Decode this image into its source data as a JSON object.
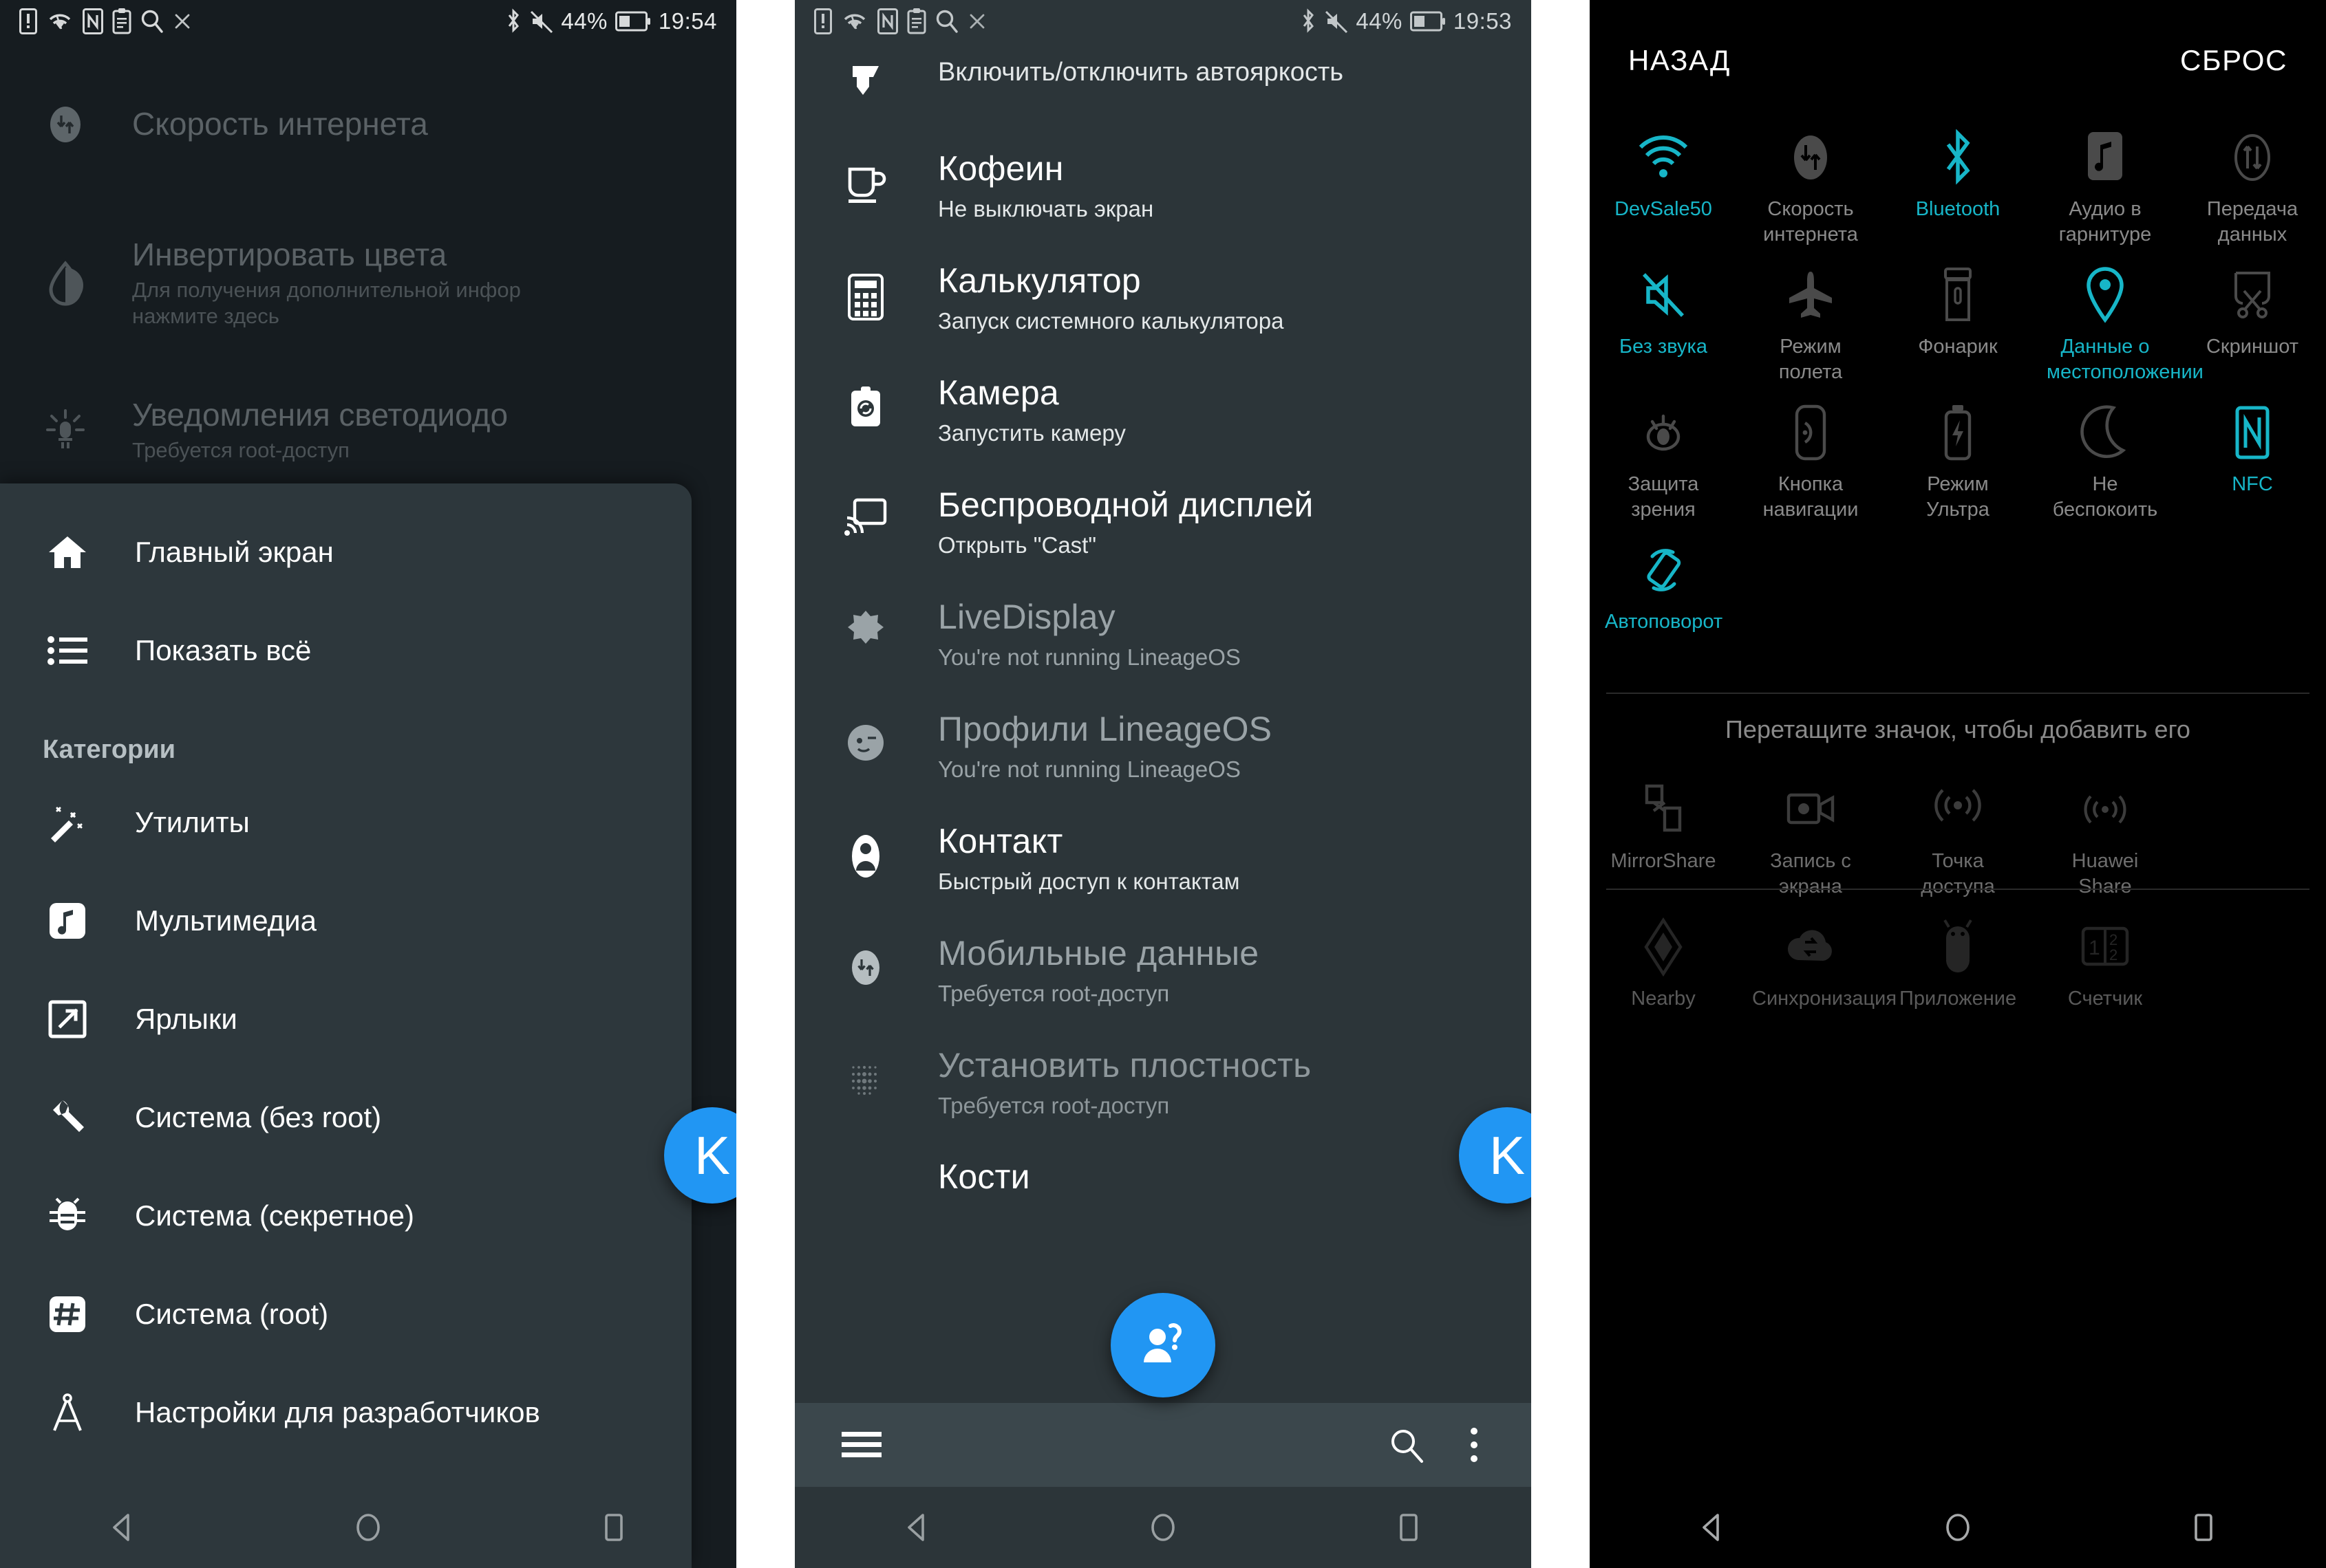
{
  "panel1": {
    "status_bar": {
      "icons": [
        "sim-alert-icon",
        "wifi-icon",
        "nfc-icon",
        "clipboard-icon",
        "search-icon",
        "close-icon"
      ],
      "right_icons": [
        "bluetooth-icon",
        "mute-icon",
        "battery-icon"
      ],
      "battery_percent": "44%",
      "clock": "19:54"
    },
    "background_rows": [
      {
        "title": "Скорость интернета",
        "sub": "",
        "icon": "data-transfer-icon"
      },
      {
        "title": "Инвертировать цвета",
        "sub": "Для получения дополнительной инфор\nнажмите здесь",
        "icon": "invert-colors-icon"
      },
      {
        "title": "Уведомления светодиодо",
        "sub": "Требуется root-доступ",
        "icon": "led-icon"
      }
    ],
    "drawer": {
      "top_items": [
        {
          "label": "Главный экран",
          "icon": "home-icon"
        },
        {
          "label": "Показать всё",
          "icon": "list-icon"
        }
      ],
      "section_header": "Категории",
      "category_items": [
        {
          "label": "Утилиты",
          "icon": "magic-wand-icon"
        },
        {
          "label": "Мультимедиа",
          "icon": "music-note-icon"
        },
        {
          "label": "Ярлыки",
          "icon": "shortcut-icon"
        },
        {
          "label": "Система (без root)",
          "icon": "wrench-icon"
        },
        {
          "label": "Система (секретное)",
          "icon": "bug-icon"
        },
        {
          "label": "Система (root)",
          "icon": "hash-icon"
        },
        {
          "label": "Настройки для разработчиков",
          "icon": "compass-icon"
        }
      ]
    },
    "fab": {
      "letter": "K",
      "color": "#2196f3"
    },
    "nav": [
      "back-icon",
      "home-icon",
      "recents-icon"
    ]
  },
  "panel2": {
    "status_bar": {
      "icons": [
        "sim-alert-icon",
        "wifi-icon",
        "nfc-icon",
        "clipboard-icon",
        "search-icon",
        "close-icon"
      ],
      "right_icons": [
        "bluetooth-icon",
        "mute-icon",
        "battery-icon"
      ],
      "battery_percent": "44%",
      "clock": "19:53"
    },
    "items": [
      {
        "title": "",
        "sub": "Включить/отключить автояркость",
        "icon": "brightness-auto-icon",
        "state": "normal"
      },
      {
        "title": "Кофеин",
        "sub": "Не выключать экран",
        "icon": "coffee-cup-icon",
        "state": "normal"
      },
      {
        "title": "Калькулятор",
        "sub": "Запуск системного калькулятора",
        "icon": "calculator-icon",
        "state": "normal"
      },
      {
        "title": "Камера",
        "sub": "Запустить камеру",
        "icon": "camera-icon",
        "state": "normal"
      },
      {
        "title": "Беспроводной дисплей",
        "sub": "Открыть \"Cast\"",
        "icon": "cast-icon",
        "state": "normal"
      },
      {
        "title": "LiveDisplay",
        "sub": "You're not running LineageOS",
        "icon": "livedisplay-icon",
        "state": "dim"
      },
      {
        "title": "Профили LineageOS",
        "sub": "You're not running LineageOS",
        "icon": "profile-face-icon",
        "state": "dim"
      },
      {
        "title": "Контакт",
        "sub": "Быстрый доступ к контактам",
        "icon": "contact-icon",
        "state": "normal"
      },
      {
        "title": "Мобильные данные",
        "sub": "Требуется root-доступ",
        "icon": "data-transfer-icon",
        "state": "dim"
      },
      {
        "title": "Установить плостность",
        "sub": "Требуется root-доступ",
        "icon": "density-dots-icon",
        "state": "dimmer"
      },
      {
        "title": "Кости",
        "sub": "",
        "icon": "dice-icon",
        "state": "normal"
      }
    ],
    "bottom_bar": {
      "menu_icon": "hamburger-menu-icon",
      "search_icon": "search-icon",
      "overflow_icon": "overflow-menu-icon"
    },
    "fab": {
      "icon": "person-question-icon",
      "color": "#2196f3"
    },
    "fab_side": {
      "letter": "K",
      "color": "#2196f3"
    },
    "nav": [
      "back-icon",
      "home-icon",
      "recents-icon"
    ]
  },
  "panel3": {
    "header": {
      "back_label": "НАЗАД",
      "reset_label": "СБРОС"
    },
    "active_color": "#17b6c8",
    "tiles": [
      {
        "label": "DevSale50",
        "icon": "wifi-icon",
        "on": true
      },
      {
        "label": "Скорость интернета",
        "icon": "data-transfer-icon",
        "on": false
      },
      {
        "label": "Bluetooth",
        "icon": "bluetooth-icon",
        "on": true
      },
      {
        "label": "Аудио в гарнитуре",
        "icon": "headset-audio-icon",
        "on": false
      },
      {
        "label": "Передача данных",
        "icon": "data-sync-icon",
        "on": false
      },
      {
        "label": "Без звука",
        "icon": "mute-icon",
        "on": true
      },
      {
        "label": "Режим полета",
        "icon": "airplane-icon",
        "on": false
      },
      {
        "label": "Фонарик",
        "icon": "flashlight-icon",
        "on": false
      },
      {
        "label": "Данные о местоположении",
        "icon": "location-pin-icon",
        "on": true
      },
      {
        "label": "Скриншот",
        "icon": "screenshot-scissors-icon",
        "on": false
      },
      {
        "label": "Защита зрения",
        "icon": "eye-comfort-icon",
        "on": false
      },
      {
        "label": "Кнопка навигации",
        "icon": "nav-button-icon",
        "on": false
      },
      {
        "label": "Режим Ультра",
        "icon": "battery-ultra-icon",
        "on": false
      },
      {
        "label": "Не беспокоить",
        "icon": "moon-icon",
        "on": false
      },
      {
        "label": "NFC",
        "icon": "nfc-icon",
        "on": true
      },
      {
        "label": "Автоповорот",
        "icon": "autorotate-icon",
        "on": true
      }
    ],
    "hint": "Перетащите значок, чтобы добавить его",
    "available_tiles": [
      {
        "label": "MirrorShare",
        "icon": "mirrorshare-icon"
      },
      {
        "label": "Запись с экрана",
        "icon": "screen-record-icon"
      },
      {
        "label": "Точка доступа",
        "icon": "hotspot-icon"
      },
      {
        "label": "Huawei Share",
        "icon": "huawei-share-icon"
      }
    ],
    "disabled_tiles": [
      {
        "label": "Nearby",
        "icon": "nearby-diamond-icon"
      },
      {
        "label": "Синхронизация",
        "icon": "sync-cloud-icon"
      },
      {
        "label": "Приложение",
        "icon": "android-bug-icon"
      },
      {
        "label": "Счетчик",
        "icon": "counter-icon"
      }
    ],
    "nav": [
      "back-icon",
      "home-icon",
      "recents-icon"
    ]
  }
}
